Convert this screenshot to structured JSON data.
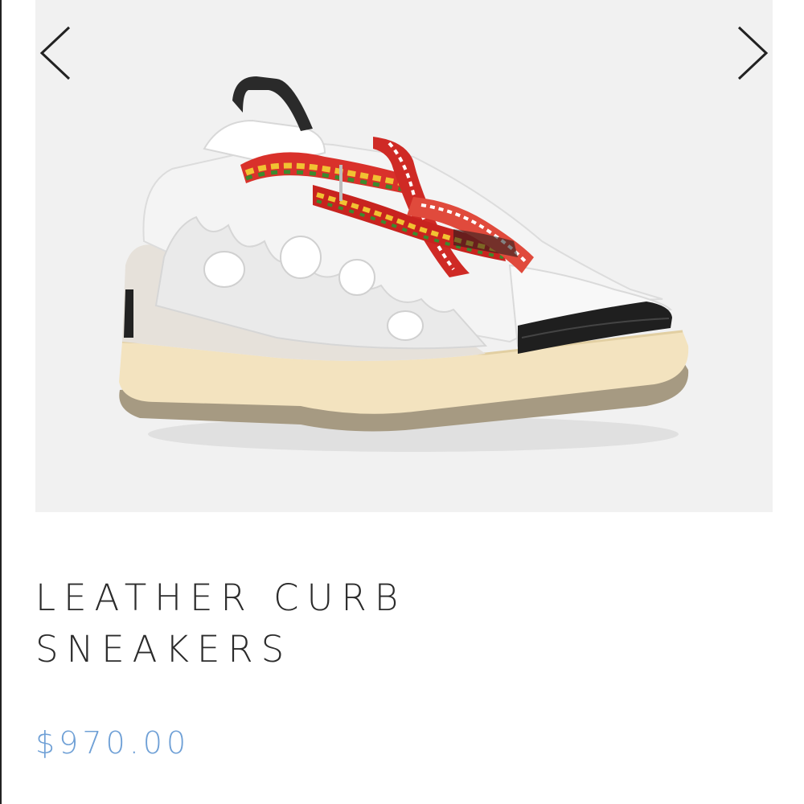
{
  "gallery": {
    "prev_icon": "chevron-left-icon",
    "next_icon": "chevron-right-icon",
    "image_subject": "sneaker-photo"
  },
  "product": {
    "title_line1": "LEATHER CURB",
    "title_line2": "SNEAKERS",
    "price": "$970.00"
  },
  "colors": {
    "price": "#6fa0d6",
    "title": "#2b2b2b",
    "gallery_bg": "#f1f1f1"
  }
}
